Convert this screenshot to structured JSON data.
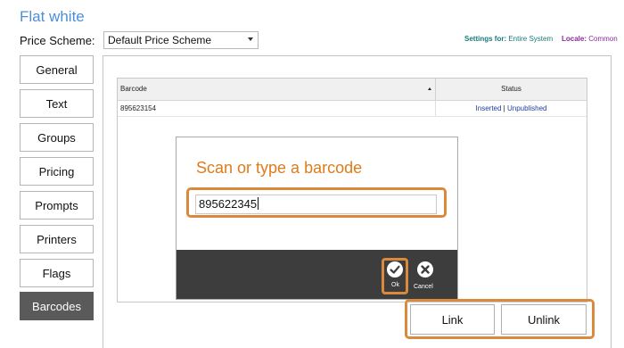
{
  "header": {
    "title": "Flat white",
    "price_scheme_label": "Price Scheme:",
    "price_scheme_value": "Default Price Scheme",
    "settings_for_label": "Settings for:",
    "settings_for_value": "Entire System",
    "locale_label": "Locale:",
    "locale_value": "Common"
  },
  "nav": {
    "items": [
      {
        "label": "General"
      },
      {
        "label": "Text"
      },
      {
        "label": "Groups"
      },
      {
        "label": "Pricing"
      },
      {
        "label": "Prompts"
      },
      {
        "label": "Printers"
      },
      {
        "label": "Flags"
      },
      {
        "label": "Barcodes",
        "active": true
      }
    ]
  },
  "grid": {
    "columns": [
      "Barcode",
      "Status"
    ],
    "rows": [
      {
        "barcode": "895623154",
        "status_inserted": "Inserted",
        "status_sep": "|",
        "status_published": "Unpublished"
      }
    ]
  },
  "dialog": {
    "title": "Scan or type a barcode",
    "input_value": "895622345",
    "ok_label": "Ok",
    "cancel_label": "Cancel"
  },
  "actions": {
    "link_label": "Link",
    "unlink_label": "Unlink"
  },
  "colors": {
    "title": "#4a90d9",
    "accent_highlight": "#d98a3c",
    "dialog_title": "#e07b1c",
    "active_nav": "#5a5a5a",
    "dialog_footer": "#3d3d3d"
  },
  "icons": {
    "ok": "check-circle-icon",
    "cancel": "close-circle-icon",
    "sort": "sort-asc-icon",
    "dropdown": "chevron-down-icon"
  }
}
